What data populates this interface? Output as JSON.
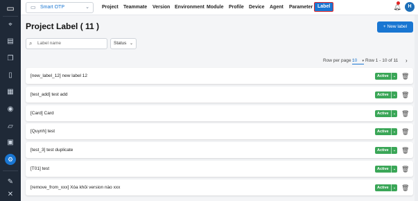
{
  "sidebar": {
    "items": [
      {
        "icon": "logo-icon"
      },
      {
        "icon": "pin-icon"
      },
      {
        "icon": "clipboard-icon"
      },
      {
        "icon": "book-icon"
      },
      {
        "icon": "grid-icon"
      },
      {
        "icon": "play-circle-icon"
      },
      {
        "icon": "document-icon"
      },
      {
        "icon": "note-icon"
      },
      {
        "icon": "settings-icon",
        "active": true
      },
      {
        "icon": "edit-icon"
      },
      {
        "icon": "tools-icon"
      }
    ]
  },
  "header": {
    "project_select": "Smart OTP",
    "nav": [
      "Project",
      "Teammate",
      "Version",
      "Environment",
      "Module",
      "Profile",
      "Device",
      "Agent",
      "Parameter",
      "Label"
    ],
    "active_nav": "Label",
    "notification_count_visible": true,
    "avatar_initial": "H"
  },
  "main": {
    "title": "Project Label ( 11 )",
    "new_button": "New label",
    "new_button_icon": "+",
    "search": {
      "placeholder": "Label name"
    },
    "status_filter": "Status",
    "pagination": {
      "rows_per_page_label": "Row per page :",
      "rows_per_page_value": "10",
      "range": "Row 1 - 10 of 11"
    },
    "rows": [
      {
        "label": "[new_label_12] new label 12",
        "status": "Active"
      },
      {
        "label": "[test_add] test add",
        "status": "Active"
      },
      {
        "label": "[Card] Card",
        "status": "Active"
      },
      {
        "label": "[Quynh] test",
        "status": "Active"
      },
      {
        "label": "[test_3] test duplicate",
        "status": "Active"
      },
      {
        "label": "[T01] test",
        "status": "Active"
      },
      {
        "label": "[remove_from_xxx] Xóa khỏi version nào xxx",
        "status": "Active"
      }
    ]
  },
  "colors": {
    "accent": "#1976d2",
    "active_badge": "#3aa657",
    "sidebar": "#1f2937",
    "highlight_border": "#e02424"
  }
}
